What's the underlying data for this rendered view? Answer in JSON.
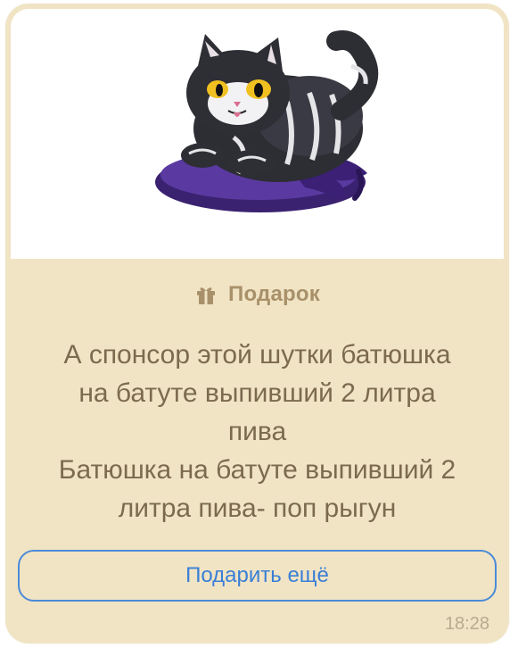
{
  "gift_card": {
    "gift_label": "Подарок",
    "message_lines": [
      "А спонсор этой шутки батюшка",
      "на батуте выпивший 2 литра",
      "пива",
      "Батюшка на батуте  выпивший 2",
      "литра пива- поп рыгун"
    ],
    "button_label": "Подарить ещё",
    "timestamp": "18:28",
    "colors": {
      "card_background": "#f1e4c4",
      "label_color": "#a8916a",
      "message_color": "#7c6a4f",
      "button_accent": "#3a7fd6",
      "timestamp_color": "#b8aa90"
    },
    "sticker_icon": "cat-on-hat-sticker",
    "gift_icon": "gift-icon"
  }
}
